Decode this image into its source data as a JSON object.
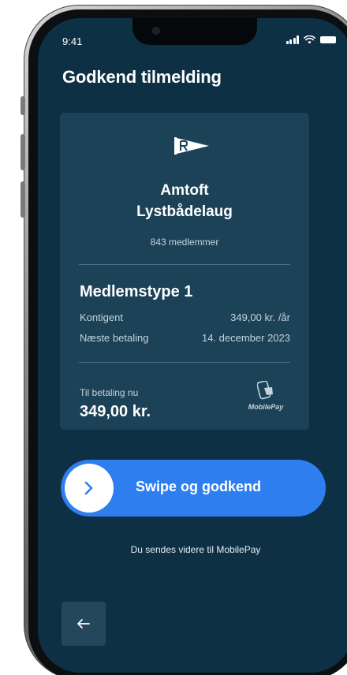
{
  "status_bar": {
    "time": "9:41",
    "icons": [
      "signal-icon",
      "wifi-icon",
      "battery-icon"
    ]
  },
  "page": {
    "title": "Godkend tilmelding"
  },
  "club": {
    "icon": "flag-icon",
    "name_line1": "Amtoft",
    "name_line2": "Lystbådelaug",
    "members": "843 medlemmer"
  },
  "membership": {
    "title": "Medlemstype 1",
    "rows": [
      {
        "label": "Kontigent",
        "value": "349,00 kr. /år"
      },
      {
        "label": "Næste betaling",
        "value": "14. december 2023"
      }
    ]
  },
  "payment": {
    "label": "Til betaling nu",
    "amount": "349,00 kr.",
    "provider_icon": "mobilepay-icon",
    "provider_name": "MobilePay"
  },
  "swipe": {
    "label": "Swipe og godkend",
    "handle_icon": "chevron-right-icon"
  },
  "redirect_note": "Du sendes videre til MobilePay",
  "back": {
    "icon": "arrow-left-icon"
  },
  "colors": {
    "screen_bg": "#0e3045",
    "card_bg": "#1c4257",
    "accent_blue": "#2f7ef0",
    "text_primary": "#ffffff",
    "text_secondary": "#c4d3dc"
  }
}
